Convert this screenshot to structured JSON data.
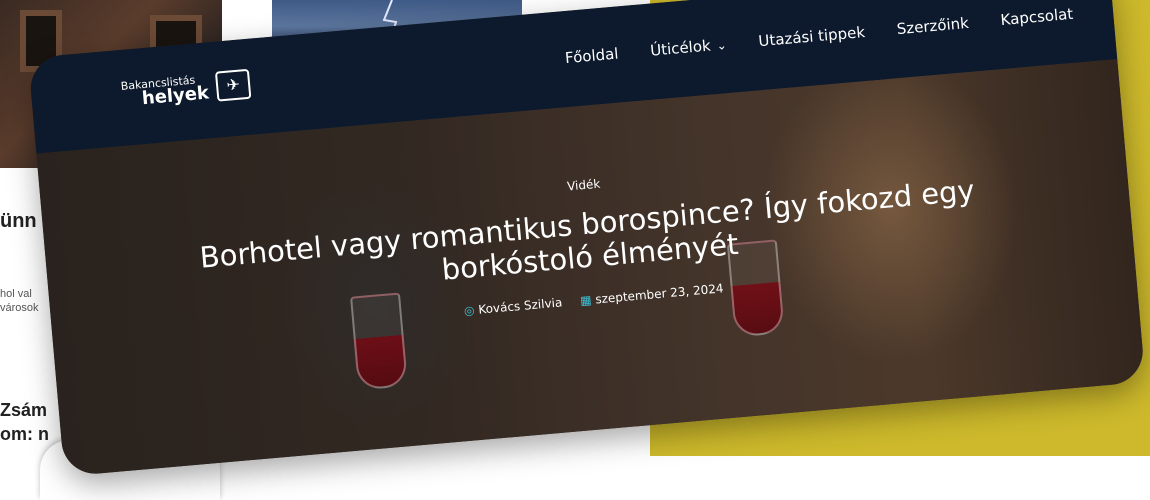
{
  "background": {
    "left_heading": "ünn",
    "left_snippet_1": "hol val",
    "left_snippet_2": "városok",
    "left_heading_2_line_1": "Zsám",
    "left_heading_2_line_2": "om: n"
  },
  "nav": {
    "logo_top": "Bakancslistás",
    "logo_bottom": "helyek",
    "items": [
      "Főoldal",
      "Úticélok",
      "Utazási tippek",
      "Szerzőink",
      "Kapcsolat"
    ]
  },
  "hero": {
    "category": "Vidék",
    "title": "Borhotel vagy romantikus borospince? Így fokozd egy borkóstoló élményét",
    "author": "Kovács Szilvia",
    "date": "szeptember 23, 2024"
  },
  "colors": {
    "nav_bg": "#0d1a2d",
    "accent_yellow": "#cdb92b",
    "meta_icon": "#3fc1d6"
  }
}
